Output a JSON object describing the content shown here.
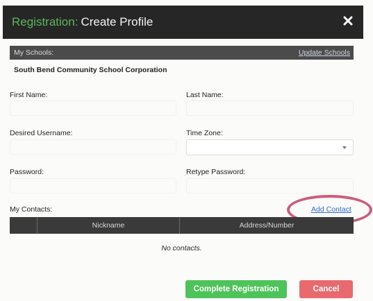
{
  "header": {
    "title_accent": "Registration:",
    "title_main": "Create Profile",
    "close_icon": "close-icon",
    "colors": {
      "bar": "#262626",
      "accent": "#5cb85c"
    }
  },
  "schools": {
    "label": "My Schools:",
    "update_link": "Update Schools",
    "school_name": "South Bend Community School Corporation"
  },
  "form": {
    "first_name_label": "First Name:",
    "last_name_label": "Last Name:",
    "username_label": "Desired Username:",
    "timezone_label": "Time Zone:",
    "password_label": "Password:",
    "retype_password_label": "Retype Password:",
    "first_name_value": "",
    "last_name_value": "",
    "username_value": "",
    "timezone_value": "",
    "password_value": "",
    "retype_password_value": ""
  },
  "contacts": {
    "label": "My Contacts:",
    "add_link": "Add Contact",
    "columns": [
      "",
      "Nickname",
      "Address/Number"
    ],
    "empty_text": "No contacts."
  },
  "actions": {
    "complete_label": "Complete Registration",
    "cancel_label": "Cancel",
    "complete_color": "#4ec35a",
    "cancel_color": "#e86a6f"
  }
}
